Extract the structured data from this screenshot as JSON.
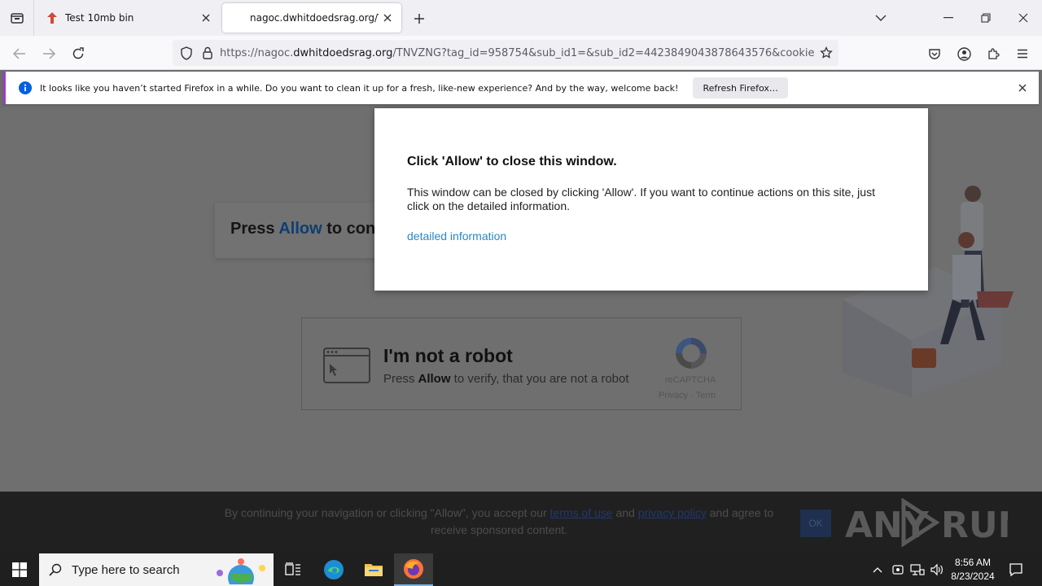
{
  "tabs": [
    {
      "title": "Test 10mb bin",
      "active": false
    },
    {
      "title": "nagoc.dwhitdoedsrag.org/TNVZ",
      "active": true
    }
  ],
  "navbar": {
    "url_prefix": "https://nagoc.",
    "url_host": "dwhitdoedsrag.org",
    "url_rest": "/TNVZNG?tag_id=958754&sub_id1=&sub_id2=4423849043878643576&cookie_id="
  },
  "infobar": {
    "message": "It looks like you haven’t started Firefox in a while. Do you want to clean it up for a fresh, like-new experience? And by the way, welcome back!",
    "button": "Refresh Firefox…"
  },
  "page": {
    "press_prefix": "Press ",
    "press_allow": "Allow",
    "press_suffix": " to con",
    "robot_title": "I'm not a robot",
    "robot_sub_prefix": "Press ",
    "robot_sub_allow": "Allow",
    "robot_sub_suffix": " to verify, that you are not a robot",
    "recaptcha": "reCAPTCHA",
    "privacy_terms": "Privacy - Term"
  },
  "popup": {
    "title": "Click 'Allow' to close this window.",
    "body": "This window can be closed by clicking 'Allow'. If you want to continue actions on this site, just click on the detailed information.",
    "link": "detailed information"
  },
  "bottom": {
    "text_1": "By continuing your navigation or clicking \"Allow\", you accept our ",
    "link_1": "terms of use",
    "text_2": " and ",
    "link_2": "privacy policy",
    "text_3": " and agree to receive sponsored content.",
    "ok": "OK",
    "watermark": "ANY RUN"
  },
  "taskbar": {
    "search_placeholder": "Type here to search",
    "time": "8:56 AM",
    "date": "8/23/2024"
  },
  "colors": {
    "link_blue": "#2c86c5",
    "infobar_accent": "#a13cc8"
  }
}
